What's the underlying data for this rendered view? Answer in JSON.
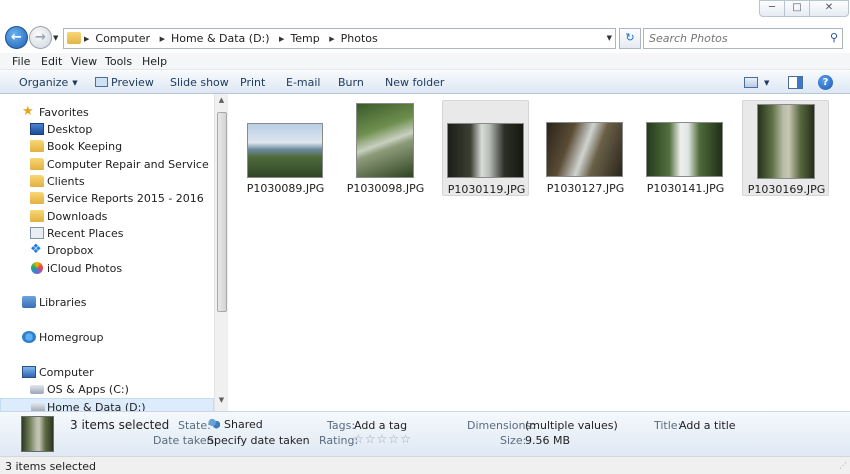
{
  "breadcrumb": [
    "Computer",
    "Home & Data (D:)",
    "Temp",
    "Photos"
  ],
  "search": {
    "placeholder": "Search Photos"
  },
  "menu": [
    "File",
    "Edit",
    "View",
    "Tools",
    "Help"
  ],
  "commands": {
    "organize": "Organize",
    "preview": "Preview",
    "slideshow": "Slide show",
    "print": "Print",
    "email": "E-mail",
    "burn": "Burn",
    "new_folder": "New folder"
  },
  "nav": {
    "favorites": "Favorites",
    "favorites_items": [
      "Desktop",
      "Book Keeping",
      "Computer Repair and Service",
      "Clients",
      "Service Reports 2015 - 2016",
      "Downloads",
      "Recent Places",
      "Dropbox",
      "iCloud Photos"
    ],
    "libraries": "Libraries",
    "homegroup": "Homegroup",
    "computer": "Computer",
    "drives": [
      "OS & Apps (C:)",
      "Home & Data (D:)"
    ]
  },
  "files": [
    {
      "name": "P1030089.JPG",
      "selected": false
    },
    {
      "name": "P1030098.JPG",
      "selected": false
    },
    {
      "name": "P1030119.JPG",
      "selected": true
    },
    {
      "name": "P1030127.JPG",
      "selected": false
    },
    {
      "name": "P1030141.JPG",
      "selected": false
    },
    {
      "name": "P1030169.JPG",
      "selected": true
    }
  ],
  "details": {
    "count": "3 items selected",
    "state_label": "State:",
    "state_value": "Shared",
    "tags_label": "Tags:",
    "tags_value": "Add a tag",
    "dimensions_label": "Dimensions:",
    "dimensions_value": "(multiple values)",
    "title_label": "Title:",
    "title_value": "Add a title",
    "date_label": "Date taken:",
    "date_value": "Specify date taken",
    "rating_label": "Rating:",
    "size_label": "Size:",
    "size_value": "9.56 MB"
  },
  "status": "3 items selected",
  "icons": [
    "back-arrow-icon",
    "forward-arrow-icon",
    "folder-icon",
    "refresh-icon",
    "search-icon",
    "star-icon",
    "dropbox-icon",
    "shared-icon",
    "help-icon"
  ]
}
